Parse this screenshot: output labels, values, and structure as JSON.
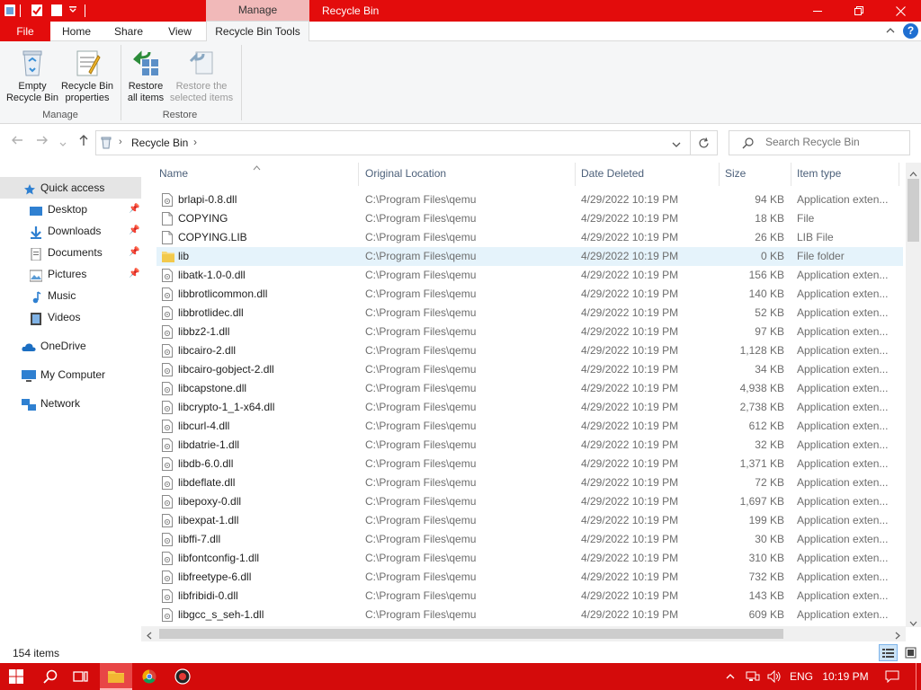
{
  "window": {
    "title": "Recycle Bin",
    "context_tab_header": "Manage"
  },
  "tabs": {
    "file": "File",
    "home": "Home",
    "share": "Share",
    "view": "View",
    "recycle_bin_tools": "Recycle Bin Tools"
  },
  "ribbon": {
    "empty_line1": "Empty",
    "empty_line2": "Recycle Bin",
    "properties_line1": "Recycle Bin",
    "properties_line2": "properties",
    "manage_group": "Manage",
    "restore_all_line1": "Restore",
    "restore_all_line2": "all items",
    "restore_sel_line1": "Restore the",
    "restore_sel_line2": "selected items",
    "restore_group": "Restore"
  },
  "address": {
    "path": "Recycle Bin",
    "search_placeholder": "Search Recycle Bin"
  },
  "nav": {
    "quick_access": "Quick access",
    "desktop": "Desktop",
    "downloads": "Downloads",
    "documents": "Documents",
    "pictures": "Pictures",
    "music": "Music",
    "videos": "Videos",
    "onedrive": "OneDrive",
    "my_computer": "My Computer",
    "network": "Network"
  },
  "columns": {
    "name": "Name",
    "location": "Original Location",
    "date": "Date Deleted",
    "size": "Size",
    "type": "Item type"
  },
  "files": [
    {
      "name": "brlapi-0.8.dll",
      "location": "C:\\Program Files\\qemu",
      "date": "4/29/2022 10:19 PM",
      "size": "94 KB",
      "type": "Application exten...",
      "kind": "dll"
    },
    {
      "name": "COPYING",
      "location": "C:\\Program Files\\qemu",
      "date": "4/29/2022 10:19 PM",
      "size": "18 KB",
      "type": "File",
      "kind": "file"
    },
    {
      "name": "COPYING.LIB",
      "location": "C:\\Program Files\\qemu",
      "date": "4/29/2022 10:19 PM",
      "size": "26 KB",
      "type": "LIB File",
      "kind": "file"
    },
    {
      "name": "lib",
      "location": "C:\\Program Files\\qemu",
      "date": "4/29/2022 10:19 PM",
      "size": "0 KB",
      "type": "File folder",
      "kind": "folder"
    },
    {
      "name": "libatk-1.0-0.dll",
      "location": "C:\\Program Files\\qemu",
      "date": "4/29/2022 10:19 PM",
      "size": "156 KB",
      "type": "Application exten...",
      "kind": "dll"
    },
    {
      "name": "libbrotlicommon.dll",
      "location": "C:\\Program Files\\qemu",
      "date": "4/29/2022 10:19 PM",
      "size": "140 KB",
      "type": "Application exten...",
      "kind": "dll"
    },
    {
      "name": "libbrotlidec.dll",
      "location": "C:\\Program Files\\qemu",
      "date": "4/29/2022 10:19 PM",
      "size": "52 KB",
      "type": "Application exten...",
      "kind": "dll"
    },
    {
      "name": "libbz2-1.dll",
      "location": "C:\\Program Files\\qemu",
      "date": "4/29/2022 10:19 PM",
      "size": "97 KB",
      "type": "Application exten...",
      "kind": "dll"
    },
    {
      "name": "libcairo-2.dll",
      "location": "C:\\Program Files\\qemu",
      "date": "4/29/2022 10:19 PM",
      "size": "1,128 KB",
      "type": "Application exten...",
      "kind": "dll"
    },
    {
      "name": "libcairo-gobject-2.dll",
      "location": "C:\\Program Files\\qemu",
      "date": "4/29/2022 10:19 PM",
      "size": "34 KB",
      "type": "Application exten...",
      "kind": "dll"
    },
    {
      "name": "libcapstone.dll",
      "location": "C:\\Program Files\\qemu",
      "date": "4/29/2022 10:19 PM",
      "size": "4,938 KB",
      "type": "Application exten...",
      "kind": "dll"
    },
    {
      "name": "libcrypto-1_1-x64.dll",
      "location": "C:\\Program Files\\qemu",
      "date": "4/29/2022 10:19 PM",
      "size": "2,738 KB",
      "type": "Application exten...",
      "kind": "dll"
    },
    {
      "name": "libcurl-4.dll",
      "location": "C:\\Program Files\\qemu",
      "date": "4/29/2022 10:19 PM",
      "size": "612 KB",
      "type": "Application exten...",
      "kind": "dll"
    },
    {
      "name": "libdatrie-1.dll",
      "location": "C:\\Program Files\\qemu",
      "date": "4/29/2022 10:19 PM",
      "size": "32 KB",
      "type": "Application exten...",
      "kind": "dll"
    },
    {
      "name": "libdb-6.0.dll",
      "location": "C:\\Program Files\\qemu",
      "date": "4/29/2022 10:19 PM",
      "size": "1,371 KB",
      "type": "Application exten...",
      "kind": "dll"
    },
    {
      "name": "libdeflate.dll",
      "location": "C:\\Program Files\\qemu",
      "date": "4/29/2022 10:19 PM",
      "size": "72 KB",
      "type": "Application exten...",
      "kind": "dll"
    },
    {
      "name": "libepoxy-0.dll",
      "location": "C:\\Program Files\\qemu",
      "date": "4/29/2022 10:19 PM",
      "size": "1,697 KB",
      "type": "Application exten...",
      "kind": "dll"
    },
    {
      "name": "libexpat-1.dll",
      "location": "C:\\Program Files\\qemu",
      "date": "4/29/2022 10:19 PM",
      "size": "199 KB",
      "type": "Application exten...",
      "kind": "dll"
    },
    {
      "name": "libffi-7.dll",
      "location": "C:\\Program Files\\qemu",
      "date": "4/29/2022 10:19 PM",
      "size": "30 KB",
      "type": "Application exten...",
      "kind": "dll"
    },
    {
      "name": "libfontconfig-1.dll",
      "location": "C:\\Program Files\\qemu",
      "date": "4/29/2022 10:19 PM",
      "size": "310 KB",
      "type": "Application exten...",
      "kind": "dll"
    },
    {
      "name": "libfreetype-6.dll",
      "location": "C:\\Program Files\\qemu",
      "date": "4/29/2022 10:19 PM",
      "size": "732 KB",
      "type": "Application exten...",
      "kind": "dll"
    },
    {
      "name": "libfribidi-0.dll",
      "location": "C:\\Program Files\\qemu",
      "date": "4/29/2022 10:19 PM",
      "size": "143 KB",
      "type": "Application exten...",
      "kind": "dll"
    },
    {
      "name": "libgcc_s_seh-1.dll",
      "location": "C:\\Program Files\\qemu",
      "date": "4/29/2022 10:19 PM",
      "size": "609 KB",
      "type": "Application exten...",
      "kind": "dll"
    }
  ],
  "status": {
    "item_count": "154 items"
  },
  "taskbar": {
    "language": "ENG",
    "time": "10:19 PM"
  },
  "colors": {
    "accent": "#e30c0c",
    "taskbar": "#d40b0b",
    "context_tab": "#f1b9b9",
    "selection": "#e5f3fb"
  }
}
